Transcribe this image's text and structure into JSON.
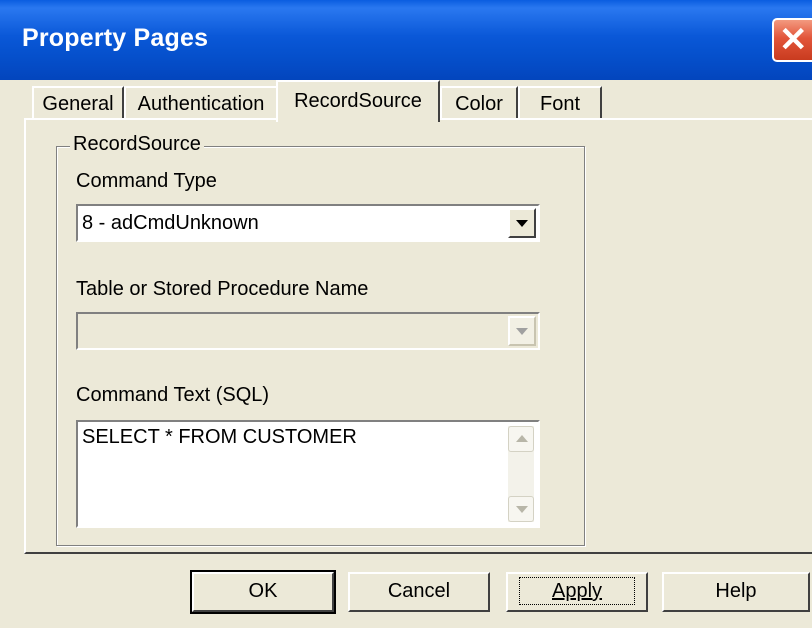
{
  "window": {
    "title": "Property Pages",
    "close_glyph": "✕"
  },
  "tabs": [
    {
      "label": "General",
      "active": false
    },
    {
      "label": "Authentication",
      "active": false
    },
    {
      "label": "RecordSource",
      "active": true
    },
    {
      "label": "Color",
      "active": false
    },
    {
      "label": "Font",
      "active": false
    }
  ],
  "recordsource": {
    "group_label": "RecordSource",
    "command_type_label": "Command Type",
    "command_type_value": "8 - adCmdUnknown",
    "table_label": "Table or Stored Procedure Name",
    "table_value": "",
    "command_text_label": "Command Text (SQL)",
    "command_text_value": "SELECT * FROM CUSTOMER"
  },
  "buttons": {
    "ok": "OK",
    "cancel": "Cancel",
    "apply": "Apply",
    "help": "Help"
  }
}
